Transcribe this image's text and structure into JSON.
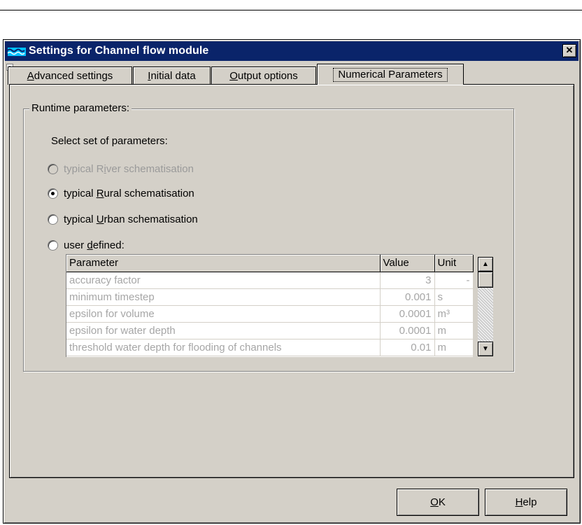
{
  "window": {
    "title": "Settings for Channel flow module"
  },
  "tabs": [
    {
      "pre": "",
      "key": "A",
      "post": "dvanced settings",
      "active": false
    },
    {
      "pre": "",
      "key": "I",
      "post": "nitial data",
      "active": false
    },
    {
      "pre": "",
      "key": "O",
      "post": "utput options",
      "active": false
    },
    {
      "pre": "Numerical Parameters",
      "key": "",
      "post": "",
      "active": true
    }
  ],
  "runtime": {
    "group_title": "Runtime parameters:",
    "select_label": "Select set of parameters:",
    "options": [
      {
        "pre": "typical R",
        "key": "i",
        "post": "ver schematisation",
        "checked": false,
        "disabled": true
      },
      {
        "pre": "typical ",
        "key": "R",
        "post": "ural schematisation",
        "checked": true,
        "disabled": false
      },
      {
        "pre": "typical ",
        "key": "U",
        "post": "rban schematisation",
        "checked": false,
        "disabled": false
      },
      {
        "pre": "user ",
        "key": "d",
        "post": "efined:",
        "checked": false,
        "disabled": false
      }
    ]
  },
  "table": {
    "headers": [
      "Parameter",
      "Value",
      "Unit"
    ],
    "rows": [
      [
        "accuracy factor",
        "3",
        "-"
      ],
      [
        "minimum timestep",
        "0.001",
        "s"
      ],
      [
        "epsilon for volume",
        "0.0001",
        "m³"
      ],
      [
        "epsilon for water depth",
        "0.0001",
        "m"
      ],
      [
        "threshold water depth for flooding of channels",
        "0.01",
        "m"
      ]
    ]
  },
  "buttons": {
    "ok": {
      "key": "O",
      "post": "K"
    },
    "help": {
      "key": "H",
      "post": "elp"
    }
  }
}
